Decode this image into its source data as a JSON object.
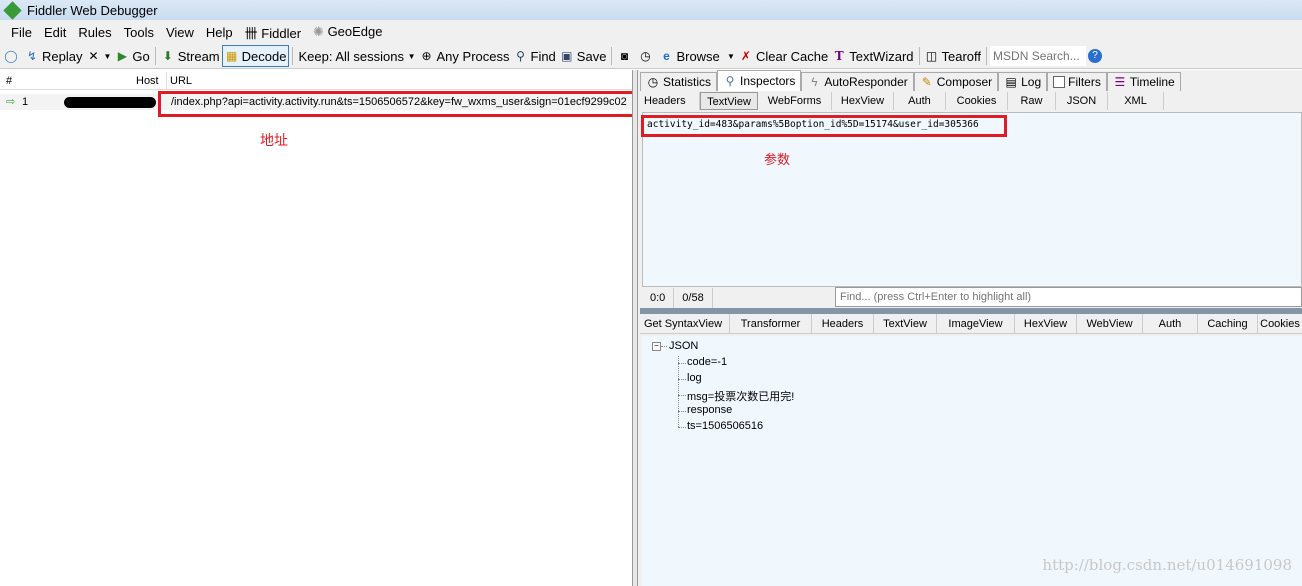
{
  "window": {
    "title": "Fiddler Web Debugger"
  },
  "menu": [
    "File",
    "Edit",
    "Rules",
    "Tools",
    "View",
    "Help",
    "Fiddler",
    "GeoEdge"
  ],
  "toolbar": {
    "replay": "Replay",
    "go": "Go",
    "stream": "Stream",
    "decode": "Decode",
    "keep": "Keep: All sessions",
    "process": "Any Process",
    "find": "Find",
    "save": "Save",
    "browse": "Browse",
    "clear_cache": "Clear Cache",
    "textwizard": "TextWizard",
    "tearoff": "Tearoff",
    "msdn_placeholder": "MSDN Search..."
  },
  "sessions": {
    "headers": [
      "#",
      "Host",
      "URL"
    ],
    "rows": [
      {
        "num": "1",
        "url": "/index.php?api=activity.activity.run&ts=1506506572&key=fw_wxms_user&sign=01ecf9299c02"
      }
    ]
  },
  "annotations": {
    "address": "地址",
    "params": "参数"
  },
  "inspector_tabs": [
    "Statistics",
    "Inspectors",
    "AutoResponder",
    "Composer",
    "Log",
    "Filters",
    "Timeline"
  ],
  "request_tabs": [
    "Headers",
    "TextView",
    "WebForms",
    "HexView",
    "Auth",
    "Cookies",
    "Raw",
    "JSON",
    "XML"
  ],
  "request_body": "activity_id=483&params%5Boption_id%5D=15174&user_id=305366",
  "status": {
    "pos": "0:0",
    "count": "0/58",
    "find_placeholder": "Find... (press Ctrl+Enter to highlight all)"
  },
  "response_tabs": [
    "Get SyntaxView",
    "Transformer",
    "Headers",
    "TextView",
    "ImageView",
    "HexView",
    "WebView",
    "Auth",
    "Caching",
    "Cookies"
  ],
  "json_tree": {
    "root": "JSON",
    "children": [
      "code=-1",
      "log",
      "msg=投票次数已用完!",
      "response",
      "ts=1506506516"
    ]
  },
  "watermark": "http://blog.csdn.net/u014691098",
  "colors": {
    "annotation_red": "#e01b24",
    "pane_bg": "#f0f7fd"
  }
}
